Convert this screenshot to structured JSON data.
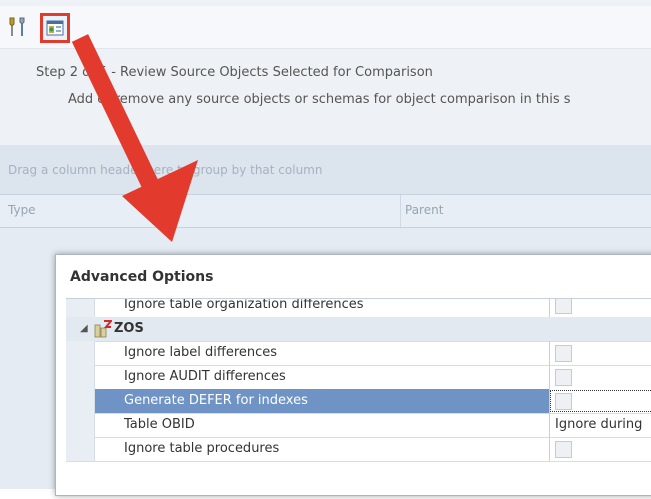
{
  "toolbar": {
    "tools_icon": "tools-icon",
    "advanced_icon": "advanced-options-icon"
  },
  "wizard": {
    "title": "Step 2 of 5 - Review Source Objects Selected for Comparison",
    "description": "Add or remove any source objects or schemas for object comparison in this s"
  },
  "grid": {
    "group_hint": "Drag a column header here to group by that column",
    "columns": [
      "Type",
      "Parent"
    ]
  },
  "dialog": {
    "title": "Advanced Options",
    "rows": [
      {
        "label": "Ignore table organization differences",
        "kind": "checkbox"
      },
      {
        "label": "ZOS",
        "kind": "category"
      },
      {
        "label": "Ignore label differences",
        "kind": "checkbox"
      },
      {
        "label": "Ignore AUDIT differences",
        "kind": "checkbox"
      },
      {
        "label": "Generate DEFER for indexes",
        "kind": "checkbox",
        "selected": true
      },
      {
        "label": "Table OBID",
        "kind": "value",
        "value": "Ignore during"
      },
      {
        "label": "Ignore table procedures",
        "kind": "checkbox"
      }
    ]
  },
  "colors": {
    "highlight": "#e23b2e",
    "selected_row": "#6e93c4"
  }
}
